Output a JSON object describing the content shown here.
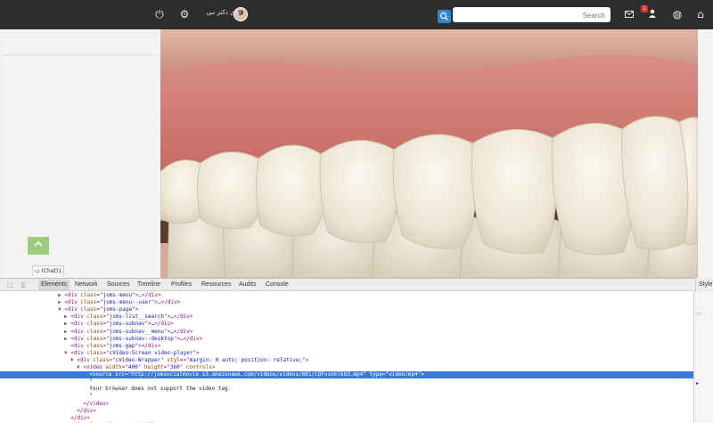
{
  "header": {
    "search_placeholder": "Search",
    "user_name": "آقای دکتر نبی",
    "notification_count": "1",
    "icons": [
      "home-icon",
      "globe-icon",
      "user-icon",
      "mail-icon",
      "search-icon",
      "gear-icon",
      "power-icon"
    ]
  },
  "sidebar": {
    "scroll_top_icon": "chevron-up-icon",
    "chat_label": "(Chat)1"
  },
  "devtools": {
    "tabs": [
      "Elements",
      "Network",
      "Sources",
      "Timeline",
      "Profiles",
      "Resources",
      "Audits",
      "Console"
    ],
    "active_tab": "Elements",
    "side_panel_label": "Style",
    "lines": [
      {
        "indent": 0,
        "tri": "▶",
        "parts": [
          [
            "tag",
            "<div "
          ],
          [
            "attr",
            "class"
          ],
          [
            "tag",
            "=\""
          ],
          [
            "val",
            "joms-menu"
          ],
          [
            "tag",
            "\">"
          ],
          [
            "txt",
            "…"
          ],
          [
            "tag",
            "</div>"
          ]
        ]
      },
      {
        "indent": 0,
        "tri": "▶",
        "parts": [
          [
            "tag",
            "<div "
          ],
          [
            "attr",
            "class"
          ],
          [
            "tag",
            "=\""
          ],
          [
            "val",
            "joms-menu--user"
          ],
          [
            "tag",
            "\">"
          ],
          [
            "txt",
            "…"
          ],
          [
            "tag",
            "</div>"
          ]
        ]
      },
      {
        "indent": 0,
        "tri": "▼",
        "parts": [
          [
            "tag",
            "<div "
          ],
          [
            "attr",
            "class"
          ],
          [
            "tag",
            "=\""
          ],
          [
            "val",
            "joms-page"
          ],
          [
            "tag",
            "\">"
          ]
        ]
      },
      {
        "indent": 1,
        "tri": "▶",
        "parts": [
          [
            "tag",
            "<div "
          ],
          [
            "attr",
            "class"
          ],
          [
            "tag",
            "=\""
          ],
          [
            "val",
            "joms-list__search"
          ],
          [
            "tag",
            "\">"
          ],
          [
            "txt",
            "…"
          ],
          [
            "tag",
            "</div>"
          ]
        ]
      },
      {
        "indent": 1,
        "tri": "▶",
        "parts": [
          [
            "tag",
            "<div "
          ],
          [
            "attr",
            "class"
          ],
          [
            "tag",
            "=\""
          ],
          [
            "val",
            "joms-subnav"
          ],
          [
            "tag",
            "\">"
          ],
          [
            "txt",
            "…"
          ],
          [
            "tag",
            "</div>"
          ]
        ]
      },
      {
        "indent": 1,
        "tri": "▶",
        "parts": [
          [
            "tag",
            "<div "
          ],
          [
            "attr",
            "class"
          ],
          [
            "tag",
            "=\""
          ],
          [
            "val",
            "joms-subnav__menu"
          ],
          [
            "tag",
            "\">"
          ],
          [
            "txt",
            "…"
          ],
          [
            "tag",
            "</div>"
          ]
        ]
      },
      {
        "indent": 1,
        "tri": "▶",
        "parts": [
          [
            "tag",
            "<div "
          ],
          [
            "attr",
            "class"
          ],
          [
            "tag",
            "=\""
          ],
          [
            "val",
            "joms-subnav--desktop"
          ],
          [
            "tag",
            "\">"
          ],
          [
            "txt",
            "…"
          ],
          [
            "tag",
            "</div>"
          ]
        ]
      },
      {
        "indent": 1,
        "tri": " ",
        "parts": [
          [
            "tag",
            "<div "
          ],
          [
            "attr",
            "class"
          ],
          [
            "tag",
            "=\""
          ],
          [
            "val",
            "joms-gap"
          ],
          [
            "tag",
            "\"></div>"
          ]
        ]
      },
      {
        "indent": 1,
        "tri": "▼",
        "parts": [
          [
            "tag",
            "<div "
          ],
          [
            "attr",
            "class"
          ],
          [
            "tag",
            "=\""
          ],
          [
            "val",
            "cVideo-Screen video-player"
          ],
          [
            "tag",
            "\">"
          ]
        ]
      },
      {
        "indent": 2,
        "tri": "▼",
        "parts": [
          [
            "tag",
            "<div "
          ],
          [
            "attr",
            "class"
          ],
          [
            "tag",
            "=\""
          ],
          [
            "val",
            "cVideo-Wrapper"
          ],
          [
            "tag",
            "\" "
          ],
          [
            "attr",
            "style"
          ],
          [
            "tag",
            "=\""
          ],
          [
            "val",
            "margin: 0 auto; position: relative;"
          ],
          [
            "tag",
            "\">"
          ]
        ]
      },
      {
        "indent": 3,
        "tri": "▼",
        "parts": [
          [
            "tag",
            "<video "
          ],
          [
            "attr",
            "width"
          ],
          [
            "tag",
            "=\""
          ],
          [
            "val",
            "400"
          ],
          [
            "tag",
            "\" "
          ],
          [
            "attr",
            "height"
          ],
          [
            "tag",
            "=\""
          ],
          [
            "val",
            "360"
          ],
          [
            "tag",
            "\" "
          ],
          [
            "attr",
            "controls"
          ],
          [
            "tag",
            ">"
          ]
        ]
      },
      {
        "indent": 4,
        "tri": " ",
        "selected": true,
        "parts": [
          [
            "tag",
            "<source "
          ],
          [
            "attr",
            "src"
          ],
          [
            "tag",
            "=\""
          ],
          [
            "val",
            "http://jomsocialmovie.s3.amazonaws.com/videos/videos/881/CDFvsVklkO3.mp4"
          ],
          [
            "tag",
            "\" "
          ],
          [
            "attr",
            "type"
          ],
          [
            "tag",
            "=\""
          ],
          [
            "val",
            "video/mp4"
          ],
          [
            "tag",
            "\">"
          ]
        ]
      },
      {
        "indent": 4,
        "tri": " ",
        "parts": [
          [
            "txt",
            "\""
          ]
        ]
      },
      {
        "indent": 4,
        "tri": " ",
        "parts": [
          [
            "txt",
            "Your browser does not support the video tag."
          ]
        ]
      },
      {
        "indent": 4,
        "tri": " ",
        "parts": [
          [
            "txt",
            "\""
          ]
        ]
      },
      {
        "indent": 3,
        "tri": " ",
        "parts": [
          [
            "tag",
            "</video>"
          ]
        ]
      },
      {
        "indent": 2,
        "tri": " ",
        "parts": [
          [
            "tag",
            "</div>"
          ]
        ]
      },
      {
        "indent": 1,
        "tri": " ",
        "parts": [
          [
            "tag",
            "</div>"
          ]
        ]
      },
      {
        "indent": 1,
        "tri": " ",
        "parts": [
          [
            "tag",
            "<div "
          ],
          [
            "attr",
            "class"
          ],
          [
            "tag",
            "=\""
          ],
          [
            "val",
            "joms-gap"
          ],
          [
            "tag",
            "\"></div>"
          ]
        ]
      }
    ]
  }
}
